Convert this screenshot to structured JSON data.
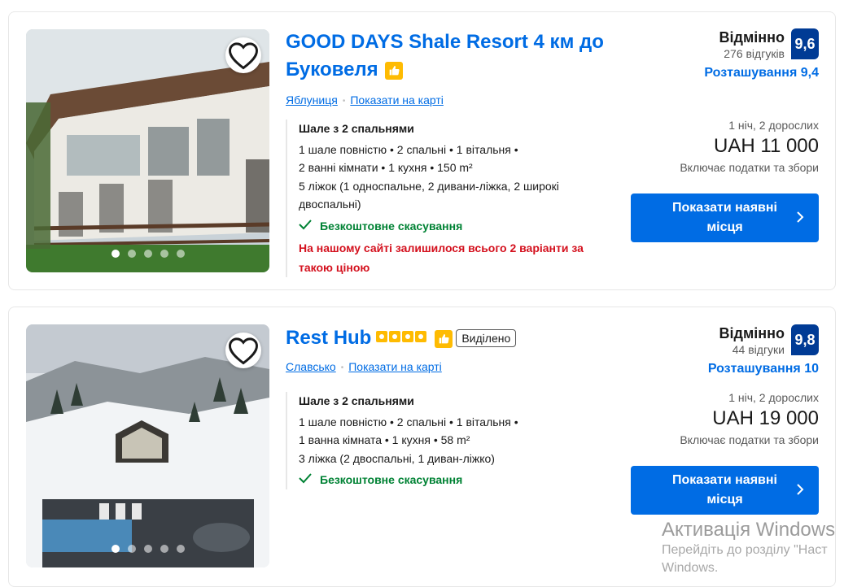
{
  "listings": [
    {
      "title": "GOOD DAYS Shale Resort 4 км до Буковеля",
      "stars": 0,
      "highlight_tag": "",
      "location": "Яблуниця",
      "map_link": "Показати на карті",
      "unit": {
        "name": "Шале з 2 спальнями",
        "details": [
          "1 шале повністю • 2 спальні • 1 вітальня •",
          "2 ванні кімнати • 1 кухня • 150 m²",
          "5 ліжок (1 односпальне, 2 дивани-ліжка, 2 широкі двоспальні)"
        ],
        "cancellation": "Безкоштовне скасування",
        "availability_warning": "На нашому сайті залишилося всього 2 варіанти за такою ціною"
      },
      "rating_word": "Відмінно",
      "reviews": "276 відгуків",
      "score": "9,6",
      "location_score": "Розташування 9,4",
      "occupancy": "1 ніч, 2 дорослих",
      "price": "UAH 11 000",
      "taxes": "Включає податки та збори",
      "cta": "Показати наявні місця",
      "photo_count": 5,
      "active_photo": 0
    },
    {
      "title": "Rest Hub",
      "stars": 4,
      "highlight_tag": "Виділено",
      "location": "Славсько",
      "map_link": "Показати на карті",
      "unit": {
        "name": "Шале з 2 спальнями",
        "details": [
          "1 шале повністю • 2 спальні • 1 вітальня •",
          "1 ванна кімната • 1 кухня • 58 m²",
          "3 ліжка (2 двоспальні, 1 диван-ліжко)"
        ],
        "cancellation": "Безкоштовне скасування",
        "availability_warning": ""
      },
      "rating_word": "Відмінно",
      "reviews": "44 відгуки",
      "score": "9,8",
      "location_score": "Розташування 10",
      "occupancy": "1 ніч, 2 дорослих",
      "price": "UAH 19 000",
      "taxes": "Включає податки та збори",
      "cta": "Показати наявні місця",
      "photo_count": 5,
      "active_photo": 0
    }
  ],
  "icons": {
    "favorite": "heart-icon",
    "preferred": "thumbs-up-icon",
    "check": "check-icon",
    "cta_arrow": "chevron-right-icon"
  },
  "colors": {
    "link": "#006ce4",
    "score_bg": "#003b95",
    "cta_bg": "#006ce4",
    "free_cancel": "#008234",
    "warning": "#d4111e",
    "star": "#febb02"
  },
  "os_watermark": {
    "title": "Активація Windows",
    "line1": "Перейдіть до розділу \"Наст",
    "line2": "Windows."
  }
}
